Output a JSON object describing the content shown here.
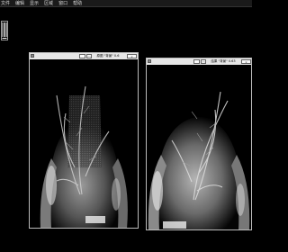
{
  "menubar": {
    "items": [
      "文件",
      "编辑",
      "显示",
      "区域",
      "窗口",
      "帮助"
    ]
  },
  "windows": [
    {
      "title": "原图 \"背景\" 0.6",
      "buttons": [
        "_",
        "□",
        "×"
      ]
    },
    {
      "title": "结果 \"背景\" 0.63",
      "buttons": [
        "_",
        "□",
        "×"
      ]
    }
  ],
  "colors": {
    "background": "#000000",
    "titlebar": "#e6e6e6",
    "window_border": "#bbbbbb"
  }
}
